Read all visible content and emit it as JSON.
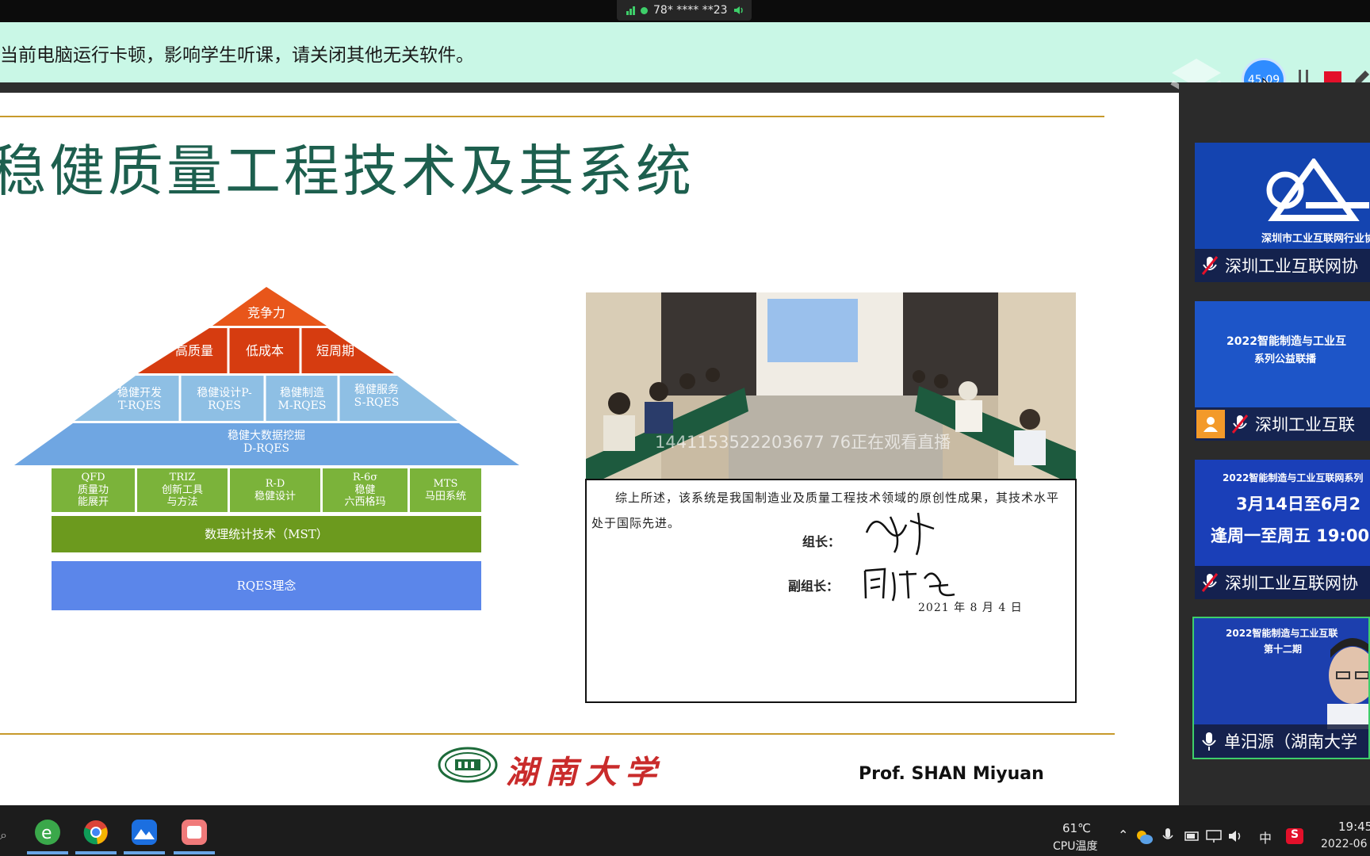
{
  "status_bar": {
    "network_text": "78* **** **23"
  },
  "notice": {
    "text": "当前电脑运行卡顿，影响学生听课，请关闭其他无关软件。"
  },
  "controls": {
    "timer": "45:09"
  },
  "slide": {
    "title": "稳健质量工程技术及其系统",
    "pyramid": {
      "apex": "竞争力",
      "tier2": [
        "高质量",
        "低成本",
        "短周期"
      ],
      "tier3": [
        {
          "line1": "稳健开发",
          "line2": "T-RQES"
        },
        {
          "line1": "稳健设计P-",
          "line2": "RQES"
        },
        {
          "line1": "稳健制造",
          "line2": "M-RQES"
        },
        {
          "line1": "稳健服务",
          "line2": "S-RQES"
        }
      ],
      "tier4": {
        "line1": "稳健大数据挖掘",
        "line2": "D-RQES"
      },
      "methods": [
        {
          "line1": "QFD",
          "line2": "质量功",
          "line3": "能展开"
        },
        {
          "line1": "TRIZ",
          "line2": "创新工具",
          "line3": "与方法"
        },
        {
          "line1": "R-D",
          "line2": "稳健设计",
          "line3": ""
        },
        {
          "line1": "R-6σ",
          "line2": "稳健",
          "line3": "六西格玛"
        },
        {
          "line1": "MTS",
          "line2": "马田系统",
          "line3": ""
        }
      ],
      "stats": "数理统计技术（MST）",
      "base": "RQES理念"
    },
    "watermark": "1441153522203677 76正在观看直播",
    "document": {
      "text": "综上所述，该系统是我国制造业及质量工程技术领域的原创性成果，其技术水平处于国际先进。",
      "leader_label": "组长：",
      "deputy_label": "副组长：",
      "date": "2021 年 8 月 4 日"
    },
    "university": "湖南大学",
    "presenter": "Prof. SHAN Miyuan"
  },
  "participants": [
    {
      "name": "深圳工业互联网协",
      "banner": "深圳市工业互联网行业协",
      "mic": "muted"
    },
    {
      "name": "深圳工业互联",
      "banner_line1": "2022智能制造与工业互",
      "banner_line2": "系列公益联播",
      "mic": "muted"
    },
    {
      "name": "深圳工业互联网协",
      "banner_line1": "2022智能制造与工业互联网系列",
      "banner_line2": "3月14日至6月2",
      "banner_line3": "逢周一至周五 19:00",
      "mic": "muted"
    },
    {
      "name": "单汨源（湖南大学",
      "banner_line1": "2022智能制造与工业互联",
      "banner_line2": "第十二期",
      "mic": "on"
    }
  ],
  "taskbar": {
    "temp": "61℃",
    "temp_label": "CPU温度",
    "ime": "中",
    "time": "19:45",
    "date": "2022-06"
  },
  "colors": {
    "notice_bg": "#c9f7e6",
    "title_green": "#1d5f4e",
    "apex_orange": "#e8561a",
    "tier2_red": "#d63c10",
    "tier3_blue": "#8ebfe4",
    "tier4_blue": "#6fa6e2",
    "methods_green": "#7bb33a",
    "stats_green": "#6c9a1e",
    "base_blue": "#5b86ea",
    "timer_blue": "#2f8cff",
    "stop_red": "#e3102a"
  }
}
